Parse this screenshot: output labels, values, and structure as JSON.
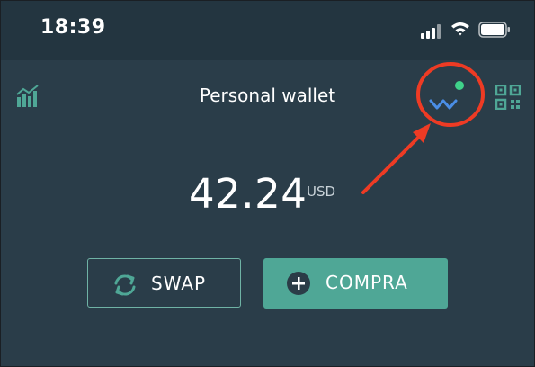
{
  "status_bar": {
    "time": "18:39"
  },
  "header": {
    "title": "Personal wallet",
    "walletconnect_status_color": "#3fd28a"
  },
  "balance": {
    "amount": "42.24",
    "currency": "USD"
  },
  "actions": {
    "swap_label": "SWAP",
    "buy_label": "COMPRA"
  },
  "icons": {
    "chart": "bar-chart-icon",
    "walletconnect": "walletconnect-icon",
    "qr": "qr-code-icon",
    "swap": "swap-arrows-icon",
    "plus": "plus-circle-icon",
    "signal": "cellular-signal-icon",
    "wifi": "wifi-icon",
    "battery": "battery-icon"
  },
  "colors": {
    "background": "#2a3d49",
    "accent": "#4fa796",
    "annotation": "#ee3b24"
  }
}
